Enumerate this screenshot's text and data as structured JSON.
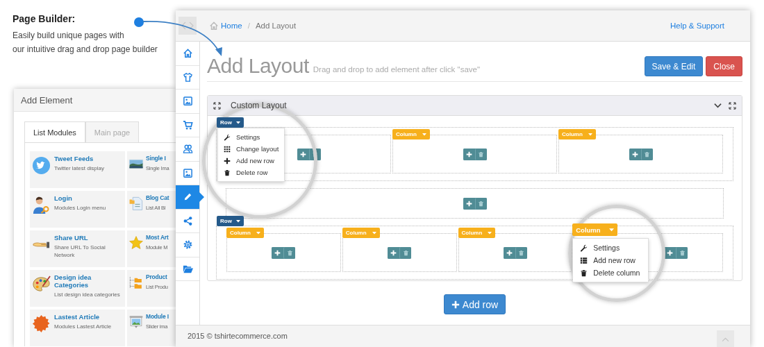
{
  "caption": {
    "title": "Page Builder:",
    "lines": [
      "Easily build unique pages with",
      "our intuitive drag and drop page builder"
    ]
  },
  "add_element": {
    "title": "Add Element",
    "tabs": [
      {
        "label": "List Modules",
        "selected": true
      },
      {
        "label": "Main page",
        "selected": false
      }
    ],
    "modules": [
      {
        "title": "Tweet Feeds",
        "description": "Twitter latest display"
      },
      {
        "title": "Single I",
        "description": "Single Ima"
      },
      {
        "title": "Login",
        "description": "Modules Login menu"
      },
      {
        "title": "Blog Cat",
        "description": "List All Bl"
      },
      {
        "title": "Share URL",
        "description": "Share URL To Social Network"
      },
      {
        "title": "Most Art",
        "description": "Module M"
      },
      {
        "title": "Design idea Categories",
        "description": "List design idea categories"
      },
      {
        "title": "Product",
        "description": "List Produ"
      },
      {
        "title": "Lastest Article",
        "description": "Modules Lastest Article"
      },
      {
        "title": "Module I",
        "description": "Slider ima"
      }
    ]
  },
  "window": {
    "breadcrumb": [
      {
        "label": "Home",
        "link": true
      },
      {
        "label": "Add Layout",
        "link": false
      }
    ],
    "separator": "/",
    "help_link": "Help & Support",
    "sidebar": [
      {
        "selected": false
      },
      {
        "selected": false
      },
      {
        "selected": false
      },
      {
        "selected": false
      },
      {
        "selected": false
      },
      {
        "selected": false
      },
      {
        "selected": true
      },
      {
        "selected": false
      },
      {
        "selected": false
      },
      {
        "selected": false
      }
    ],
    "title": "Add Layout",
    "subtitle": "Drag and drop to add element after click \"save\"",
    "buttons": [
      {
        "label": "Save & Edit",
        "kind": "primary"
      },
      {
        "label": "Close",
        "kind": "danger"
      }
    ],
    "panel": {
      "title": "Custom Layout",
      "rows": [
        {
          "tag": "Row",
          "menu": [
            "Settings",
            "Change layout",
            "Add new row",
            "Delete row"
          ],
          "columns": [
            {},
            {
              "tag": "Column"
            },
            {
              "tag": "Column"
            }
          ]
        },
        {
          "columns": [
            {}
          ]
        },
        {
          "tag": "Row",
          "columns": [
            {
              "tag": "Column"
            },
            {
              "tag": "Column"
            },
            {
              "tag": "Column"
            },
            {
              "tag": "Column",
              "menu": [
                "Settings",
                "Add new row",
                "Delete column"
              ]
            }
          ]
        }
      ]
    },
    "add_row": "Add row",
    "footer": "2015 © tshirtecommerce.com"
  }
}
